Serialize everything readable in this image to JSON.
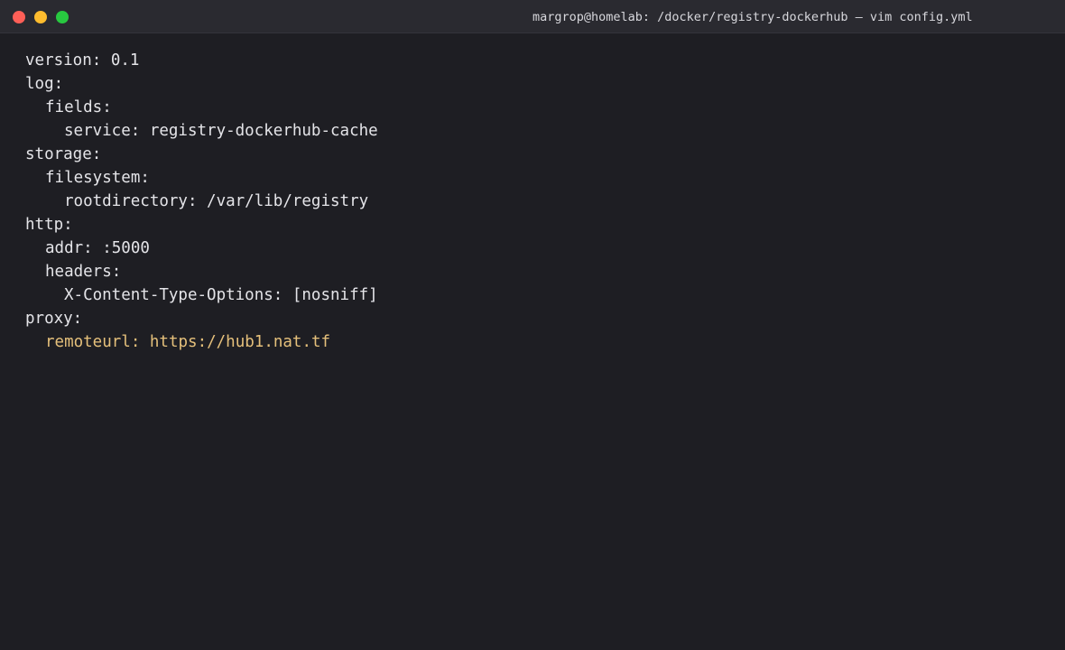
{
  "window": {
    "title": "margrop@homelab: /docker/registry-dockerhub — vim config.yml",
    "buttons": [
      "close",
      "minimize",
      "zoom"
    ]
  },
  "colors": {
    "background": "#1e1e23",
    "titlebar": "#2a2a30",
    "text": "#e4e4e8",
    "highlight": "#e5c07b",
    "close": "#fe5f57",
    "minimize": "#febc2e",
    "zoom": "#28c840"
  },
  "file": {
    "lines": [
      "version: 0.1",
      "log:",
      "fields:",
      "service: registry-dockerhub-cache",
      "storage:",
      "filesystem:",
      "rootdirectory: /var/lib/registry",
      "http:",
      "addr: :5000",
      "headers:",
      "X-Content-Type-Options: [nosniff]",
      "proxy:",
      "remoteurl: https://hub1.nat.tf"
    ]
  }
}
